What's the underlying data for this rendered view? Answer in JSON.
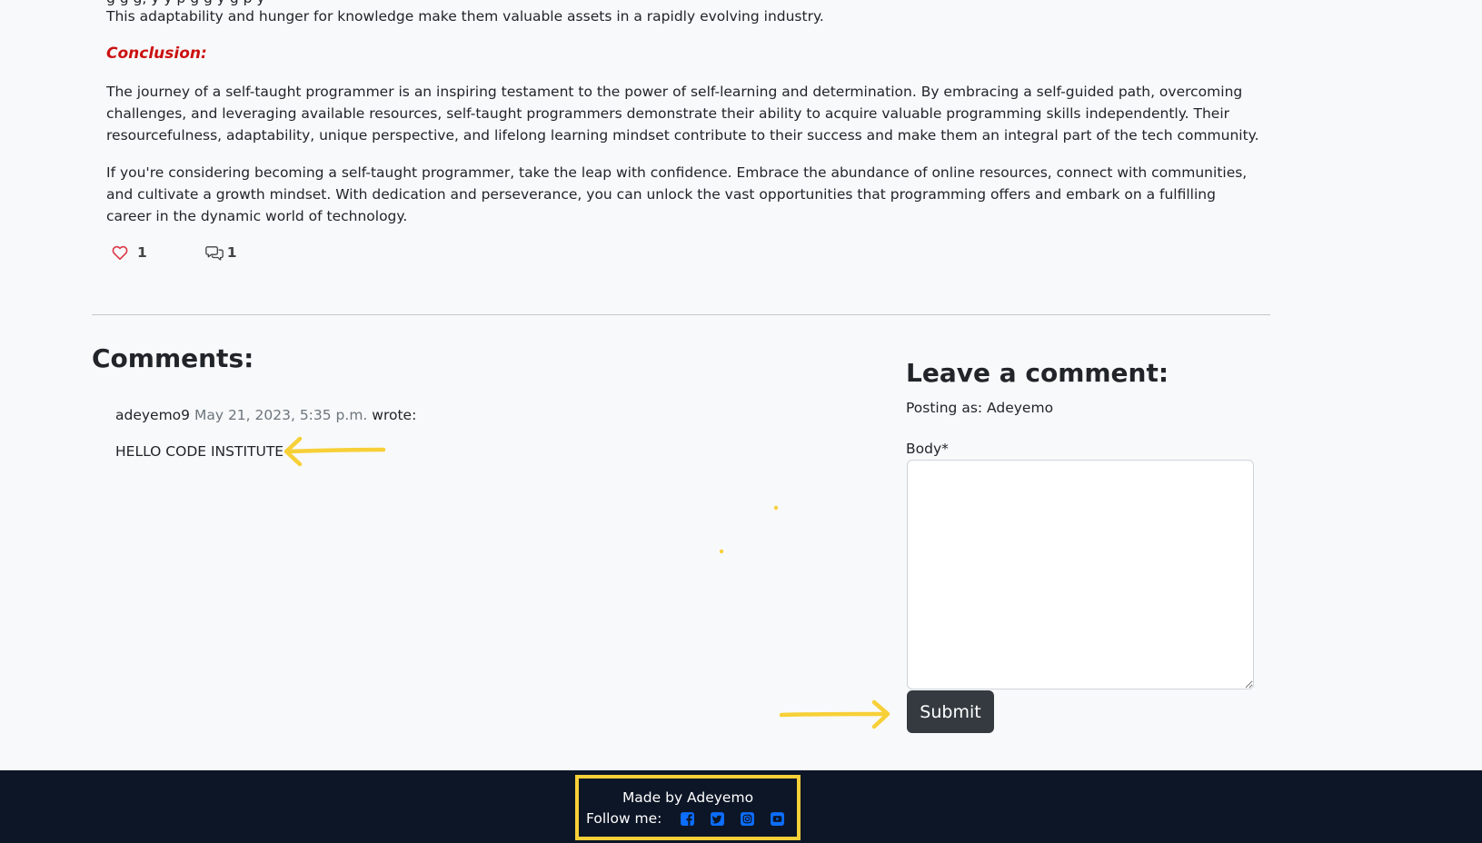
{
  "article": {
    "cut_line": "g                                     g        g,  y                                             y p  g                   g       y  g p                 y",
    "adaptability_line": "This adaptability and hunger for knowledge make them valuable assets in a rapidly evolving industry.",
    "conclusion_heading": "Conclusion:",
    "paragraph_1": "The journey of a self-taught programmer is an inspiring testament to the power of self-learning and determination. By embracing a self-guided path, overcoming challenges, and leveraging available resources, self-taught programmers demonstrate their ability to acquire valuable programming skills independently. Their resourcefulness, adaptability, unique perspective, and lifelong learning mindset contribute to their success and make them an integral part of the tech community.",
    "paragraph_2": "If you're considering becoming a self-taught programmer, take the leap with confidence. Embrace the abundance of online resources, connect with communities, and cultivate a growth mindset. With dedication and perseverance, you can unlock the vast opportunities that programming offers and embark on a fulfilling career in the dynamic world of technology."
  },
  "stats": {
    "likes": "1",
    "comments": "1",
    "like_icon": "heart-outline-icon",
    "comment_icon": "chat-bubbles-icon",
    "like_color": "#dc3545"
  },
  "comments": {
    "heading": "Comments:",
    "items": [
      {
        "author": "adeyemo9",
        "date": "May 21, 2023, 5:35 p.m.",
        "wrote": "wrote:",
        "body": "HELLO CODE INSTITUTE"
      }
    ]
  },
  "comment_form": {
    "heading": "Leave a comment:",
    "posting_as": "Posting as: Adeyemo",
    "body_label": "Body*",
    "body_value": "",
    "submit_label": "Submit"
  },
  "footer": {
    "made_by": "Made by Adeyemo",
    "follow": "Follow me:",
    "social_icons": [
      "facebook-icon",
      "twitter-icon",
      "instagram-icon",
      "youtube-icon"
    ],
    "icon_color": "#0d6efd",
    "background": "#0c1626",
    "highlight_color": "#f7d038"
  }
}
